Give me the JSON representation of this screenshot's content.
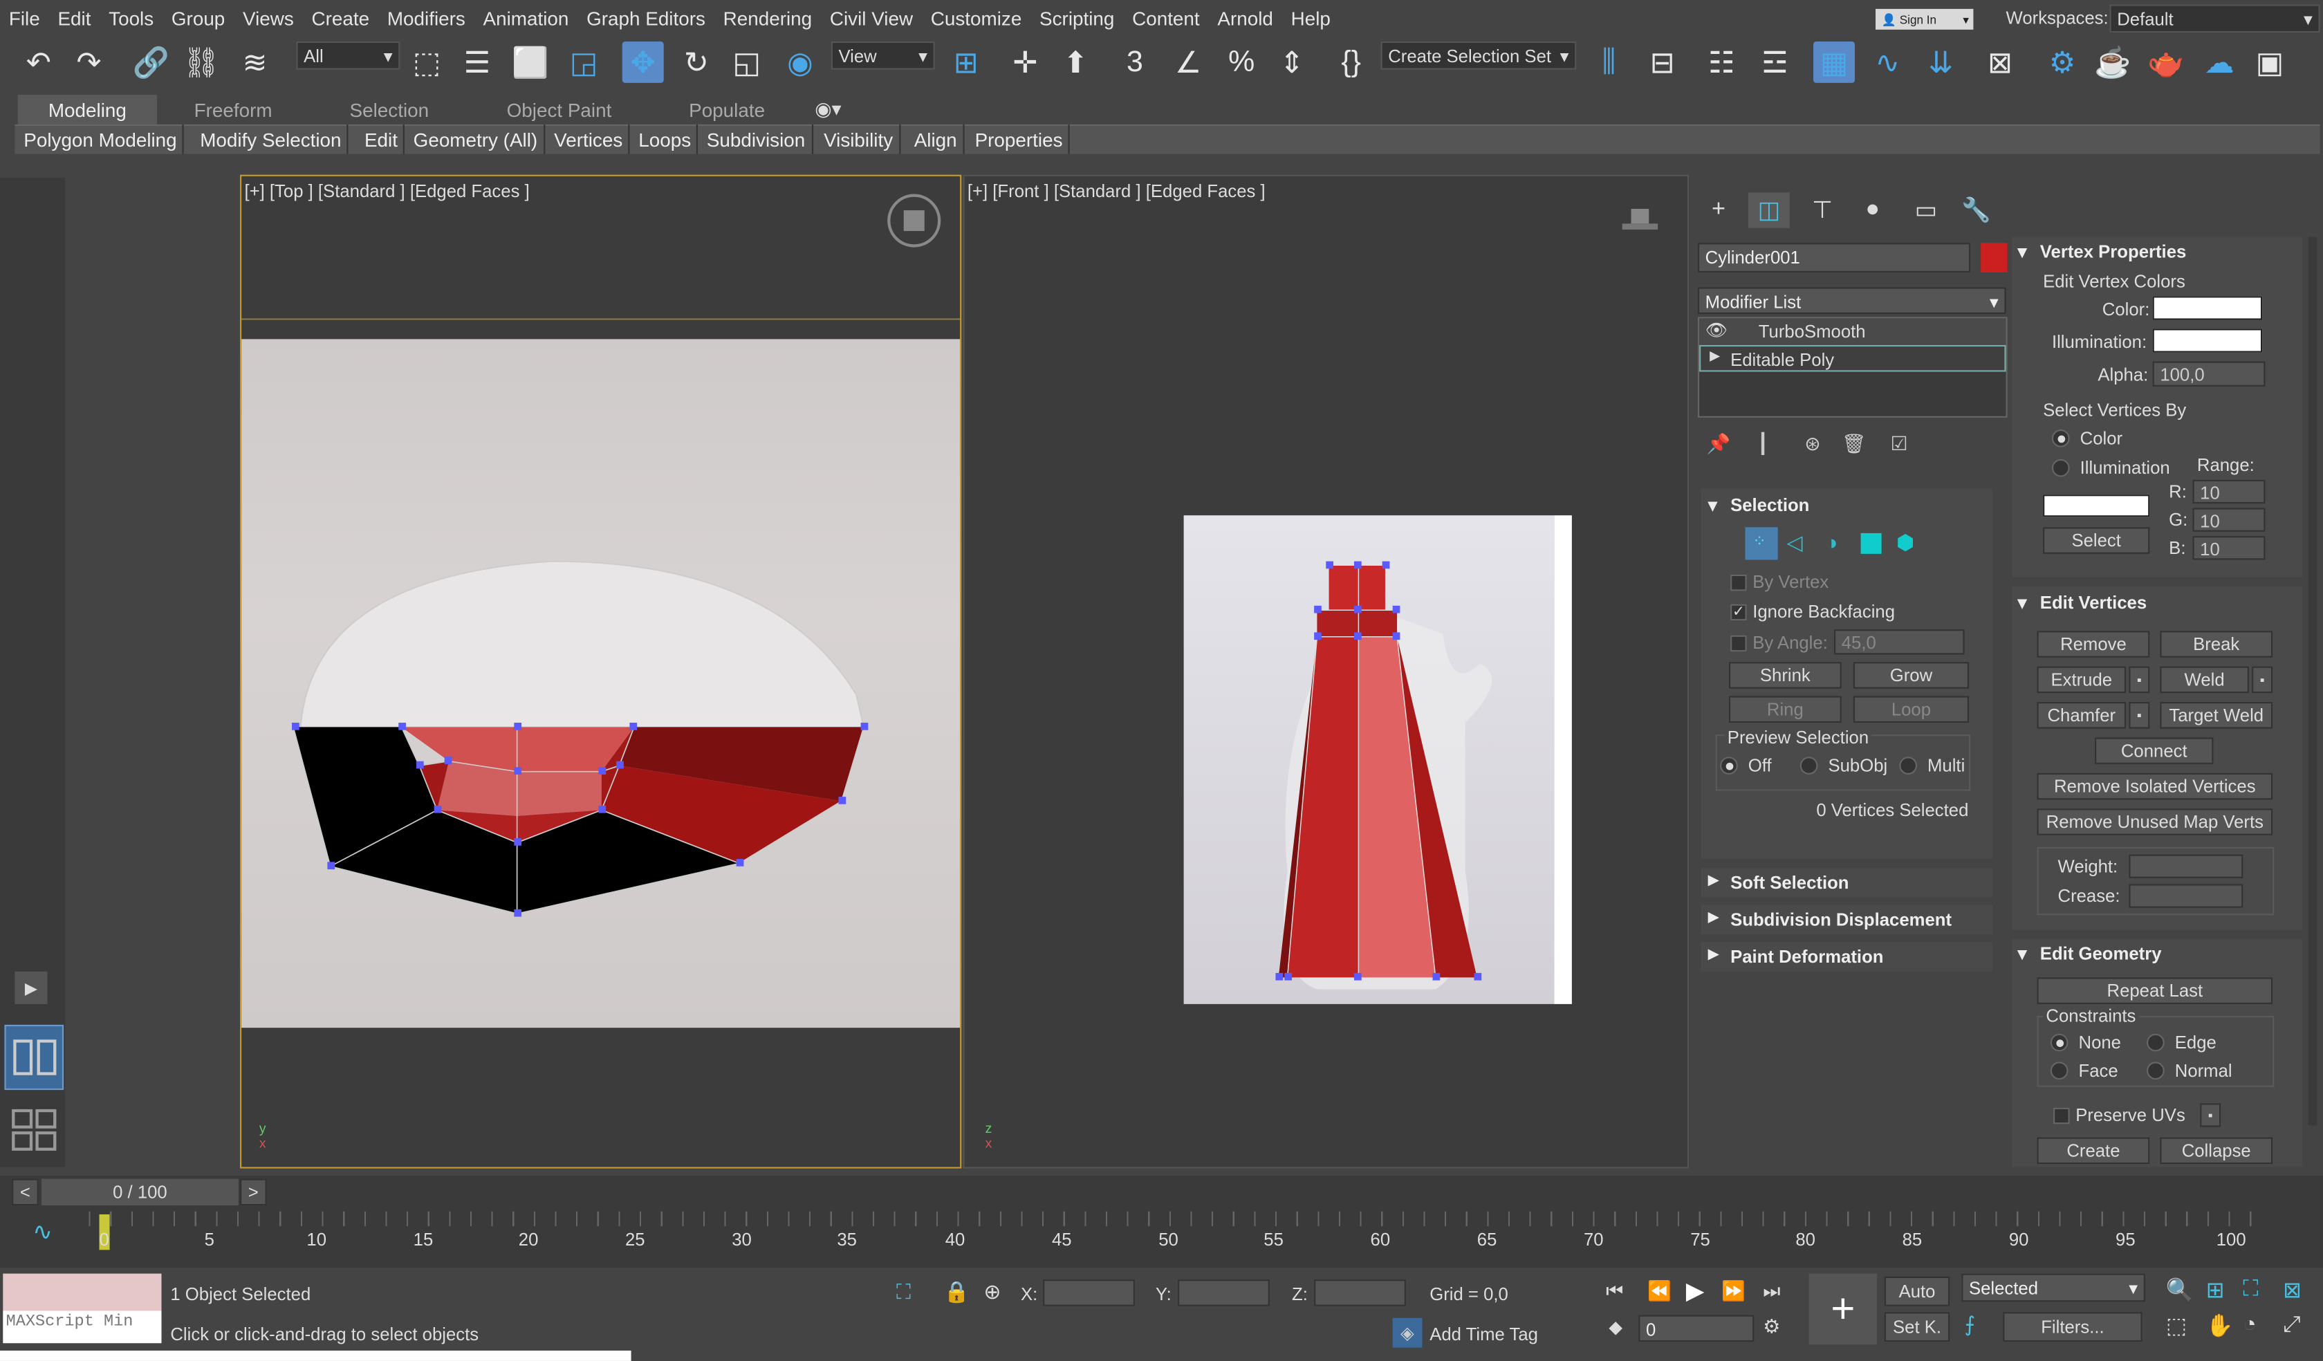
{
  "menubar": {
    "items": [
      "File",
      "Edit",
      "Tools",
      "Group",
      "Views",
      "Create",
      "Modifiers",
      "Animation",
      "Graph Editors",
      "Rendering",
      "Civil View",
      "Customize",
      "Scripting",
      "Content",
      "Arnold",
      "Help"
    ],
    "signin": "Sign In",
    "workspaces_label": "Workspaces:",
    "workspaces_value": "Default"
  },
  "toolbar": {
    "selection_filter": "All",
    "ref_coord": "View",
    "named_selection": "Create Selection Set"
  },
  "ribbon": {
    "tabs": [
      "Modeling",
      "Freeform",
      "Selection",
      "Object Paint",
      "Populate"
    ],
    "sub": [
      "Polygon Modeling",
      "Modify Selection",
      "Edit",
      "Geometry (All)",
      "Vertices",
      "Loops",
      "Subdivision",
      "Visibility",
      "Align",
      "Properties"
    ]
  },
  "viewports": {
    "top_label": "[+] [Top ] [Standard ] [Edged Faces ]",
    "front_label": "[+] [Front ] [Standard ] [Edged Faces ]"
  },
  "command_panel": {
    "object_name": "Cylinder001",
    "object_color": "#cc1f1f",
    "modifier_list": "Modifier List",
    "stack": [
      "TurboSmooth",
      "Editable Poly"
    ],
    "selection": {
      "title": "Selection",
      "by_vertex": "By Vertex",
      "ignore_backfacing": "Ignore Backfacing",
      "by_angle": "By Angle:",
      "by_angle_value": "45,0",
      "shrink": "Shrink",
      "grow": "Grow",
      "ring": "Ring",
      "loop": "Loop",
      "preview_title": "Preview Selection",
      "preview_off": "Off",
      "preview_subobj": "SubObj",
      "preview_multi": "Multi",
      "status": "0 Vertices Selected"
    },
    "collapsed_rollouts": [
      "Soft Selection",
      "Subdivision Displacement",
      "Paint Deformation"
    ],
    "vertex_properties": {
      "title": "Vertex Properties",
      "edit_colors": "Edit Vertex Colors",
      "color": "Color:",
      "illumination": "Illumination:",
      "alpha": "Alpha:",
      "alpha_value": "100,0",
      "select_by": "Select Vertices By",
      "opt_color": "Color",
      "opt_illum": "Illumination",
      "range": "Range:",
      "r": "R:",
      "g": "G:",
      "b": "B:",
      "r_val": "10",
      "g_val": "10",
      "b_val": "10",
      "select": "Select"
    },
    "edit_vertices": {
      "title": "Edit Vertices",
      "remove": "Remove",
      "break": "Break",
      "extrude": "Extrude",
      "weld": "Weld",
      "chamfer": "Chamfer",
      "target_weld": "Target Weld",
      "connect": "Connect",
      "remove_isolated": "Remove Isolated Vertices",
      "remove_unused": "Remove Unused Map Verts",
      "weight": "Weight:",
      "crease": "Crease:"
    },
    "edit_geometry": {
      "title": "Edit Geometry",
      "repeat_last": "Repeat Last",
      "constraints": "Constraints",
      "none": "None",
      "edge": "Edge",
      "face": "Face",
      "normal": "Normal",
      "preserve_uvs": "Preserve UVs",
      "create": "Create",
      "collapse": "Collapse"
    }
  },
  "timeline": {
    "frame": "0 / 100",
    "ticks": [
      "0",
      "5",
      "10",
      "15",
      "20",
      "25",
      "30",
      "35",
      "40",
      "45",
      "50",
      "55",
      "60",
      "65",
      "70",
      "75",
      "80",
      "85",
      "90",
      "95",
      "100"
    ]
  },
  "status": {
    "maxscript": "MAXScript Min",
    "selected": "1 Object Selected",
    "prompt": "Click or click-and-drag to select objects",
    "x": "X:",
    "y": "Y:",
    "z": "Z:",
    "grid": "Grid = 0,0",
    "add_time_tag": "Add Time Tag",
    "auto": "Auto",
    "setk": "Set K.",
    "key_mode": "Selected",
    "filters": "Filters...",
    "frame_field": "0"
  }
}
